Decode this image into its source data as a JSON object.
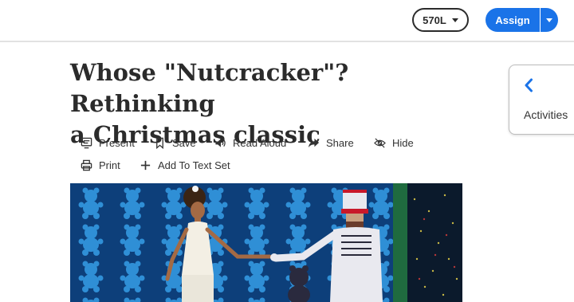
{
  "header": {
    "level_label": "570L",
    "assign_label": "Assign"
  },
  "article": {
    "title_line1": "Whose \"Nutcracker\"? Rethinking",
    "title_line2": "a Christmas classic"
  },
  "toolbar": {
    "present": "Present",
    "save": "Save",
    "read_aloud": "Read Aloud",
    "share": "Share",
    "hide": "Hide",
    "print": "Print",
    "add_to_text_set": "Add To Text Set"
  },
  "sidebar": {
    "activities_label": "Activities"
  },
  "colors": {
    "primary": "#1a73e8",
    "text": "#2b2b2b",
    "photo_background": "#0d3f7a",
    "photo_pattern": "#2f8fd6"
  },
  "icons": {
    "present": "present-icon",
    "save": "bookmark-icon",
    "read_aloud": "speaker-icon",
    "share": "share-arrow-icon",
    "hide": "eye-slash-icon",
    "print": "printer-icon",
    "add": "plus-icon",
    "activities": "chevron-left-icon"
  }
}
